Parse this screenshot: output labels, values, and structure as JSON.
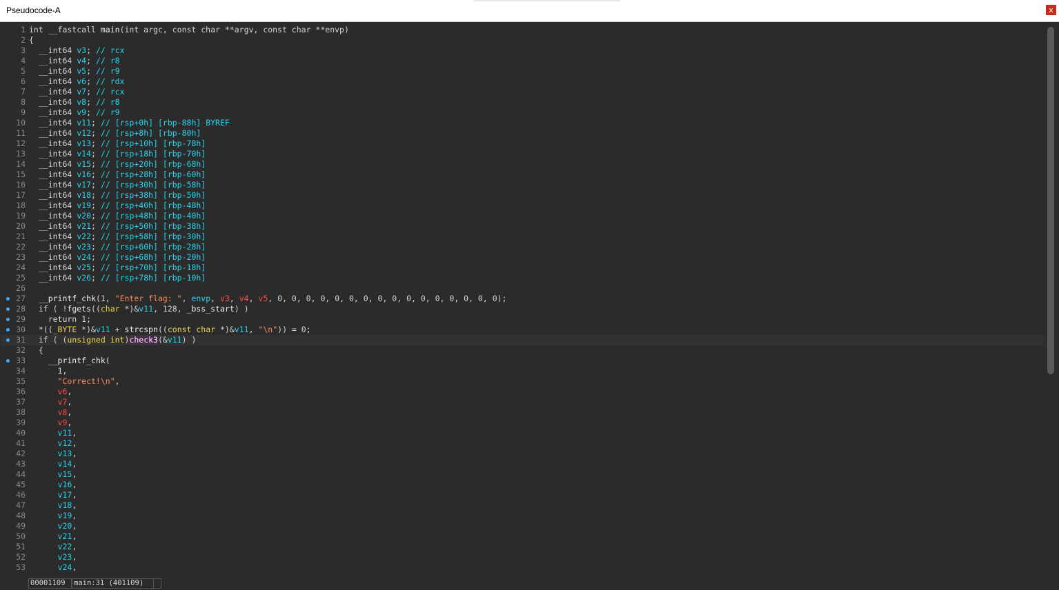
{
  "window": {
    "title": "Pseudocode-A",
    "close_label": "x"
  },
  "lines": [
    {
      "n": "1",
      "bp": false,
      "cur": false,
      "seg": [
        [
          "k",
          "int __fastcall "
        ],
        [
          "f",
          "main"
        ],
        [
          "k",
          "(int argc, const char **argv, const char **envp)"
        ]
      ]
    },
    {
      "n": "2",
      "bp": false,
      "cur": false,
      "seg": [
        [
          "k",
          "{"
        ]
      ]
    },
    {
      "n": "3",
      "bp": false,
      "cur": false,
      "seg": [
        [
          "k",
          "  __int64 "
        ],
        [
          "c",
          "v3"
        ],
        [
          "k",
          "; "
        ],
        [
          "c",
          "// rcx"
        ]
      ]
    },
    {
      "n": "4",
      "bp": false,
      "cur": false,
      "seg": [
        [
          "k",
          "  __int64 "
        ],
        [
          "c",
          "v4"
        ],
        [
          "k",
          "; "
        ],
        [
          "c",
          "// r8"
        ]
      ]
    },
    {
      "n": "5",
      "bp": false,
      "cur": false,
      "seg": [
        [
          "k",
          "  __int64 "
        ],
        [
          "c",
          "v5"
        ],
        [
          "k",
          "; "
        ],
        [
          "c",
          "// r9"
        ]
      ]
    },
    {
      "n": "6",
      "bp": false,
      "cur": false,
      "seg": [
        [
          "k",
          "  __int64 "
        ],
        [
          "c",
          "v6"
        ],
        [
          "k",
          "; "
        ],
        [
          "c",
          "// rdx"
        ]
      ]
    },
    {
      "n": "7",
      "bp": false,
      "cur": false,
      "seg": [
        [
          "k",
          "  __int64 "
        ],
        [
          "c",
          "v7"
        ],
        [
          "k",
          "; "
        ],
        [
          "c",
          "// rcx"
        ]
      ]
    },
    {
      "n": "8",
      "bp": false,
      "cur": false,
      "seg": [
        [
          "k",
          "  __int64 "
        ],
        [
          "c",
          "v8"
        ],
        [
          "k",
          "; "
        ],
        [
          "c",
          "// r8"
        ]
      ]
    },
    {
      "n": "9",
      "bp": false,
      "cur": false,
      "seg": [
        [
          "k",
          "  __int64 "
        ],
        [
          "c",
          "v9"
        ],
        [
          "k",
          "; "
        ],
        [
          "c",
          "// r9"
        ]
      ]
    },
    {
      "n": "10",
      "bp": false,
      "cur": false,
      "seg": [
        [
          "k",
          "  __int64 "
        ],
        [
          "c",
          "v11"
        ],
        [
          "k",
          "; "
        ],
        [
          "c",
          "// [rsp+0h] [rbp-88h] BYREF"
        ]
      ]
    },
    {
      "n": "11",
      "bp": false,
      "cur": false,
      "seg": [
        [
          "k",
          "  __int64 "
        ],
        [
          "c",
          "v12"
        ],
        [
          "k",
          "; "
        ],
        [
          "c",
          "// [rsp+8h] [rbp-80h]"
        ]
      ]
    },
    {
      "n": "12",
      "bp": false,
      "cur": false,
      "seg": [
        [
          "k",
          "  __int64 "
        ],
        [
          "c",
          "v13"
        ],
        [
          "k",
          "; "
        ],
        [
          "c",
          "// [rsp+10h] [rbp-78h]"
        ]
      ]
    },
    {
      "n": "13",
      "bp": false,
      "cur": false,
      "seg": [
        [
          "k",
          "  __int64 "
        ],
        [
          "c",
          "v14"
        ],
        [
          "k",
          "; "
        ],
        [
          "c",
          "// [rsp+18h] [rbp-70h]"
        ]
      ]
    },
    {
      "n": "14",
      "bp": false,
      "cur": false,
      "seg": [
        [
          "k",
          "  __int64 "
        ],
        [
          "c",
          "v15"
        ],
        [
          "k",
          "; "
        ],
        [
          "c",
          "// [rsp+20h] [rbp-68h]"
        ]
      ]
    },
    {
      "n": "15",
      "bp": false,
      "cur": false,
      "seg": [
        [
          "k",
          "  __int64 "
        ],
        [
          "c",
          "v16"
        ],
        [
          "k",
          "; "
        ],
        [
          "c",
          "// [rsp+28h] [rbp-60h]"
        ]
      ]
    },
    {
      "n": "16",
      "bp": false,
      "cur": false,
      "seg": [
        [
          "k",
          "  __int64 "
        ],
        [
          "c",
          "v17"
        ],
        [
          "k",
          "; "
        ],
        [
          "c",
          "// [rsp+30h] [rbp-58h]"
        ]
      ]
    },
    {
      "n": "17",
      "bp": false,
      "cur": false,
      "seg": [
        [
          "k",
          "  __int64 "
        ],
        [
          "c",
          "v18"
        ],
        [
          "k",
          "; "
        ],
        [
          "c",
          "// [rsp+38h] [rbp-50h]"
        ]
      ]
    },
    {
      "n": "18",
      "bp": false,
      "cur": false,
      "seg": [
        [
          "k",
          "  __int64 "
        ],
        [
          "c",
          "v19"
        ],
        [
          "k",
          "; "
        ],
        [
          "c",
          "// [rsp+40h] [rbp-48h]"
        ]
      ]
    },
    {
      "n": "19",
      "bp": false,
      "cur": false,
      "seg": [
        [
          "k",
          "  __int64 "
        ],
        [
          "c",
          "v20"
        ],
        [
          "k",
          "; "
        ],
        [
          "c",
          "// [rsp+48h] [rbp-40h]"
        ]
      ]
    },
    {
      "n": "20",
      "bp": false,
      "cur": false,
      "seg": [
        [
          "k",
          "  __int64 "
        ],
        [
          "c",
          "v21"
        ],
        [
          "k",
          "; "
        ],
        [
          "c",
          "// [rsp+50h] [rbp-38h]"
        ]
      ]
    },
    {
      "n": "21",
      "bp": false,
      "cur": false,
      "seg": [
        [
          "k",
          "  __int64 "
        ],
        [
          "c",
          "v22"
        ],
        [
          "k",
          "; "
        ],
        [
          "c",
          "// [rsp+58h] [rbp-30h]"
        ]
      ]
    },
    {
      "n": "22",
      "bp": false,
      "cur": false,
      "seg": [
        [
          "k",
          "  __int64 "
        ],
        [
          "c",
          "v23"
        ],
        [
          "k",
          "; "
        ],
        [
          "c",
          "// [rsp+60h] [rbp-28h]"
        ]
      ]
    },
    {
      "n": "23",
      "bp": false,
      "cur": false,
      "seg": [
        [
          "k",
          "  __int64 "
        ],
        [
          "c",
          "v24"
        ],
        [
          "k",
          "; "
        ],
        [
          "c",
          "// [rsp+68h] [rbp-20h]"
        ]
      ]
    },
    {
      "n": "24",
      "bp": false,
      "cur": false,
      "seg": [
        [
          "k",
          "  __int64 "
        ],
        [
          "c",
          "v25"
        ],
        [
          "k",
          "; "
        ],
        [
          "c",
          "// [rsp+70h] [rbp-18h]"
        ]
      ]
    },
    {
      "n": "25",
      "bp": false,
      "cur": false,
      "seg": [
        [
          "k",
          "  __int64 "
        ],
        [
          "c",
          "v26"
        ],
        [
          "k",
          "; "
        ],
        [
          "c",
          "// [rsp+78h] [rbp-10h]"
        ]
      ]
    },
    {
      "n": "26",
      "bp": false,
      "cur": false,
      "seg": [
        [
          "k",
          ""
        ]
      ]
    },
    {
      "n": "27",
      "bp": true,
      "cur": false,
      "seg": [
        [
          "f",
          "  __printf_chk"
        ],
        [
          "k",
          "(1, "
        ],
        [
          "s",
          "\"Enter flag: \""
        ],
        [
          "k",
          ", "
        ],
        [
          "c",
          "envp"
        ],
        [
          "k",
          ", "
        ],
        [
          "r",
          "v3"
        ],
        [
          "k",
          ", "
        ],
        [
          "r",
          "v4"
        ],
        [
          "k",
          ", "
        ],
        [
          "r",
          "v5"
        ],
        [
          "k",
          ", 0, 0, 0, 0, 0, 0, 0, 0, 0, 0, 0, 0, 0, 0, 0, 0);"
        ]
      ]
    },
    {
      "n": "28",
      "bp": true,
      "cur": false,
      "seg": [
        [
          "k",
          "  if ( !"
        ],
        [
          "f",
          "fgets"
        ],
        [
          "k",
          "(("
        ],
        [
          "y",
          "char"
        ],
        [
          "k",
          " *)&"
        ],
        [
          "c",
          "v11"
        ],
        [
          "k",
          ", 128, "
        ],
        [
          "f",
          "_bss_start"
        ],
        [
          "k",
          ") )"
        ]
      ]
    },
    {
      "n": "29",
      "bp": true,
      "cur": false,
      "seg": [
        [
          "k",
          "    return 1;"
        ]
      ]
    },
    {
      "n": "30",
      "bp": true,
      "cur": false,
      "seg": [
        [
          "k",
          "  *(("
        ],
        [
          "y",
          "_BYTE"
        ],
        [
          "k",
          " *)&"
        ],
        [
          "c",
          "v11"
        ],
        [
          "k",
          " + "
        ],
        [
          "f",
          "strcspn"
        ],
        [
          "k",
          "(("
        ],
        [
          "y",
          "const char"
        ],
        [
          "k",
          " *)&"
        ],
        [
          "c",
          "v11"
        ],
        [
          "k",
          ", "
        ],
        [
          "s",
          "\"\\n\""
        ],
        [
          "k",
          ")) = 0;"
        ]
      ]
    },
    {
      "n": "31",
      "bp": true,
      "cur": true,
      "seg": [
        [
          "k",
          "  if ( ("
        ],
        [
          "y",
          "unsigned int"
        ],
        [
          "k",
          ")"
        ],
        [
          "hl",
          "check3"
        ],
        [
          "k",
          "(&"
        ],
        [
          "c",
          "v11"
        ],
        [
          "k",
          ") )"
        ]
      ]
    },
    {
      "n": "32",
      "bp": false,
      "cur": false,
      "seg": [
        [
          "k",
          "  {"
        ]
      ]
    },
    {
      "n": "33",
      "bp": true,
      "cur": false,
      "seg": [
        [
          "f",
          "    __printf_chk"
        ],
        [
          "k",
          "("
        ]
      ]
    },
    {
      "n": "34",
      "bp": false,
      "cur": false,
      "seg": [
        [
          "k",
          "      1,"
        ]
      ]
    },
    {
      "n": "35",
      "bp": false,
      "cur": false,
      "seg": [
        [
          "s",
          "      \"Correct!\\n\""
        ],
        [
          "k",
          ","
        ]
      ]
    },
    {
      "n": "36",
      "bp": false,
      "cur": false,
      "seg": [
        [
          "r",
          "      v6"
        ],
        [
          "k",
          ","
        ]
      ]
    },
    {
      "n": "37",
      "bp": false,
      "cur": false,
      "seg": [
        [
          "r",
          "      v7"
        ],
        [
          "k",
          ","
        ]
      ]
    },
    {
      "n": "38",
      "bp": false,
      "cur": false,
      "seg": [
        [
          "r",
          "      v8"
        ],
        [
          "k",
          ","
        ]
      ]
    },
    {
      "n": "39",
      "bp": false,
      "cur": false,
      "seg": [
        [
          "r",
          "      v9"
        ],
        [
          "k",
          ","
        ]
      ]
    },
    {
      "n": "40",
      "bp": false,
      "cur": false,
      "seg": [
        [
          "c",
          "      v11"
        ],
        [
          "k",
          ","
        ]
      ]
    },
    {
      "n": "41",
      "bp": false,
      "cur": false,
      "seg": [
        [
          "c",
          "      v12"
        ],
        [
          "k",
          ","
        ]
      ]
    },
    {
      "n": "42",
      "bp": false,
      "cur": false,
      "seg": [
        [
          "c",
          "      v13"
        ],
        [
          "k",
          ","
        ]
      ]
    },
    {
      "n": "43",
      "bp": false,
      "cur": false,
      "seg": [
        [
          "c",
          "      v14"
        ],
        [
          "k",
          ","
        ]
      ]
    },
    {
      "n": "44",
      "bp": false,
      "cur": false,
      "seg": [
        [
          "c",
          "      v15"
        ],
        [
          "k",
          ","
        ]
      ]
    },
    {
      "n": "45",
      "bp": false,
      "cur": false,
      "seg": [
        [
          "c",
          "      v16"
        ],
        [
          "k",
          ","
        ]
      ]
    },
    {
      "n": "46",
      "bp": false,
      "cur": false,
      "seg": [
        [
          "c",
          "      v17"
        ],
        [
          "k",
          ","
        ]
      ]
    },
    {
      "n": "47",
      "bp": false,
      "cur": false,
      "seg": [
        [
          "c",
          "      v18"
        ],
        [
          "k",
          ","
        ]
      ]
    },
    {
      "n": "48",
      "bp": false,
      "cur": false,
      "seg": [
        [
          "c",
          "      v19"
        ],
        [
          "k",
          ","
        ]
      ]
    },
    {
      "n": "49",
      "bp": false,
      "cur": false,
      "seg": [
        [
          "c",
          "      v20"
        ],
        [
          "k",
          ","
        ]
      ]
    },
    {
      "n": "50",
      "bp": false,
      "cur": false,
      "seg": [
        [
          "c",
          "      v21"
        ],
        [
          "k",
          ","
        ]
      ]
    },
    {
      "n": "51",
      "bp": false,
      "cur": false,
      "seg": [
        [
          "c",
          "      v22"
        ],
        [
          "k",
          ","
        ]
      ]
    },
    {
      "n": "52",
      "bp": false,
      "cur": false,
      "seg": [
        [
          "c",
          "      v23"
        ],
        [
          "k",
          ","
        ]
      ]
    },
    {
      "n": "53",
      "bp": false,
      "cur": false,
      "seg": [
        [
          "c",
          "      v24"
        ],
        [
          "k",
          ","
        ]
      ]
    }
  ],
  "status": {
    "address": "00001109",
    "location": "main:31 (401109)",
    "extra": ""
  }
}
